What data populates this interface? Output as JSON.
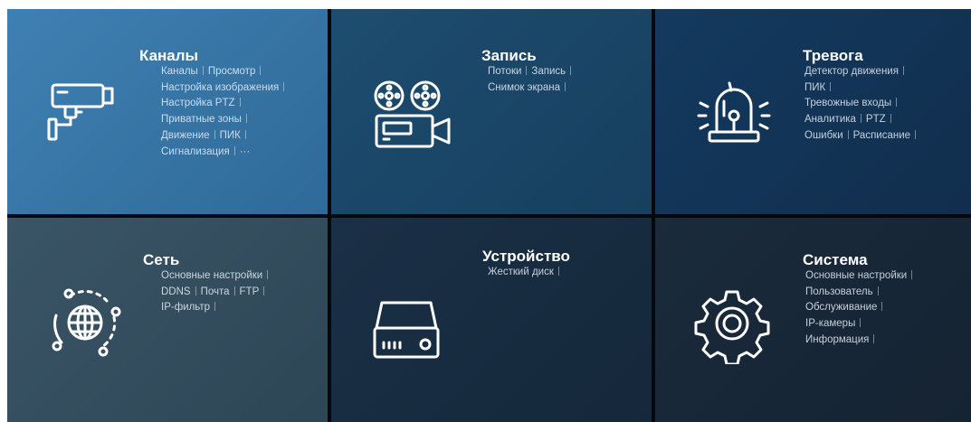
{
  "tiles": [
    {
      "id": "channels",
      "title": "Каналы",
      "icon": "camera-icon",
      "rows": [
        [
          "Каналы",
          "Просмотр"
        ],
        [
          "Настройка изображения"
        ],
        [
          "Настройка PTZ"
        ],
        [
          "Приватные зоны"
        ],
        [
          "Движение",
          "ПИК"
        ],
        [
          "Сигнализация",
          "···"
        ]
      ]
    },
    {
      "id": "record",
      "title": "Запись",
      "icon": "film-camera-icon",
      "rows": [
        [
          "Потоки",
          "Запись"
        ],
        [
          "Снимок экрана"
        ]
      ]
    },
    {
      "id": "alarm",
      "title": "Тревога",
      "icon": "siren-icon",
      "rows": [
        [
          "Детектор движения"
        ],
        [
          "ПИК"
        ],
        [
          "Тревожные входы"
        ],
        [
          "Аналитика",
          "PTZ"
        ],
        [
          "Ошибки",
          "Расписание"
        ]
      ]
    },
    {
      "id": "network",
      "title": "Сеть",
      "icon": "globe-icon",
      "rows": [
        [
          "Основные настройки"
        ],
        [
          "DDNS",
          "Почта",
          "FTP"
        ],
        [
          "IP-фильтр"
        ]
      ]
    },
    {
      "id": "device",
      "title": "Устройство",
      "icon": "hdd-icon",
      "rows": [
        [
          "Жесткий диск"
        ]
      ]
    },
    {
      "id": "system",
      "title": "Система",
      "icon": "gear-icon",
      "rows": [
        [
          "Основные настройки"
        ],
        [
          "Пользователь"
        ],
        [
          "Обслуживание"
        ],
        [
          "IP-камеры"
        ],
        [
          "Информация"
        ]
      ]
    }
  ],
  "colors": {
    "tile_channels": "#3f80b2",
    "tile_record": "#1d4d70",
    "tile_alarm": "#133a5f",
    "tile_network": "#3a5566",
    "tile_device": "#1a3046",
    "tile_system": "#1a2b3c",
    "divider": "#05080c",
    "text": "#ffffff"
  }
}
